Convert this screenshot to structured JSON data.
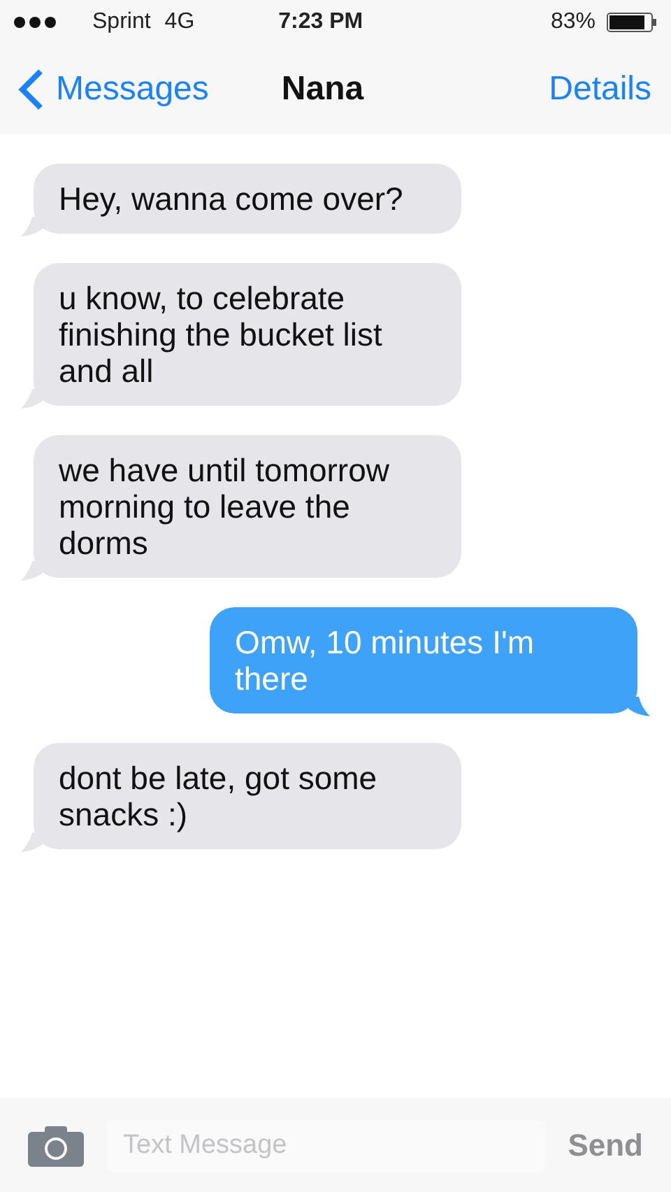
{
  "status_bar": {
    "carrier": "Sprint",
    "network": "4G",
    "time": "7:23 PM",
    "battery": "83%"
  },
  "nav": {
    "back": "Messages",
    "title": "Nana",
    "action": "Details"
  },
  "messages": [
    {
      "kind": "received",
      "text": "Hey, wanna come over?"
    },
    {
      "kind": "received",
      "text": "u know, to celebrate finishing the bucket list and all"
    },
    {
      "kind": "received",
      "text": "we have until tomorrow morning to leave the dorms"
    },
    {
      "kind": "sent",
      "text": "Omw, 10 minutes I'm there"
    },
    {
      "kind": "received",
      "text": "dont be late, got some snacks :)"
    }
  ],
  "composer": {
    "placeholder": "Text Message",
    "send": "Send"
  }
}
